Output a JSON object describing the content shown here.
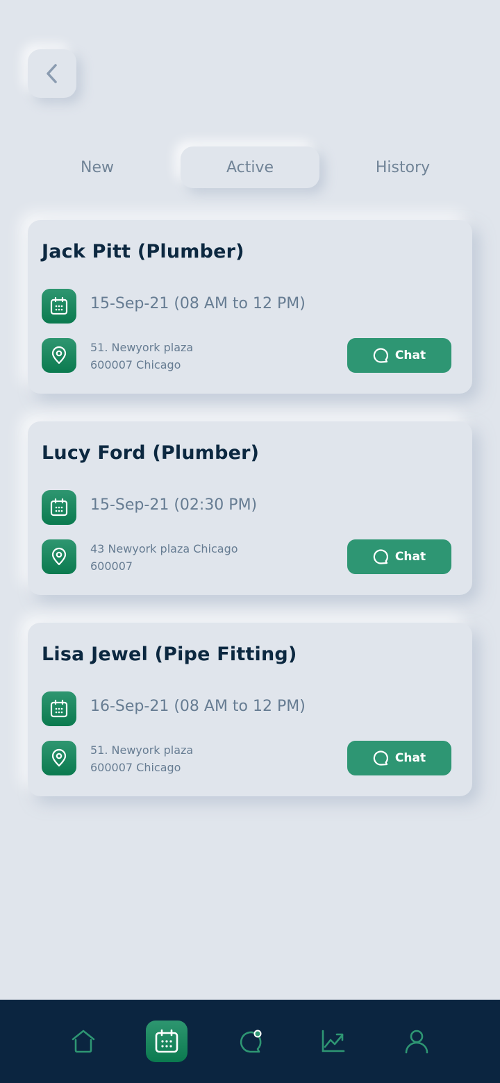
{
  "header": {
    "back_icon": "chevron-left-icon"
  },
  "tabs": [
    {
      "label": "New",
      "active": false
    },
    {
      "label": "Active",
      "active": true
    },
    {
      "label": "History",
      "active": false
    }
  ],
  "bookings": [
    {
      "title": "Jack Pitt (Plumber)",
      "date": "15-Sep-21 (08 AM to 12 PM)",
      "address_line1": "51. Newyork plaza",
      "address_line2": "600007 Chicago",
      "chat_label": "Chat"
    },
    {
      "title": "Lucy Ford (Plumber)",
      "date": "15-Sep-21 (02:30 PM)",
      "address_line1": "43 Newyork plaza Chicago",
      "address_line2": "600007",
      "chat_label": "Chat"
    },
    {
      "title": "Lisa Jewel (Pipe Fitting)",
      "date": "16-Sep-21 (08 AM to 12 PM)",
      "address_line1": "51. Newyork plaza",
      "address_line2": "600007 Chicago",
      "chat_label": "Chat"
    }
  ],
  "navbar": {
    "items": [
      {
        "icon": "home-icon",
        "active": false
      },
      {
        "icon": "calendar-icon",
        "active": true
      },
      {
        "icon": "chat-icon",
        "active": false,
        "badge": true
      },
      {
        "icon": "chart-icon",
        "active": false
      },
      {
        "icon": "profile-icon",
        "active": false
      }
    ]
  },
  "colors": {
    "background": "#e0e5ec",
    "accent": "#2e9673",
    "navbar": "#0b2540",
    "title": "#0c2840",
    "muted_text": "#667c92"
  }
}
